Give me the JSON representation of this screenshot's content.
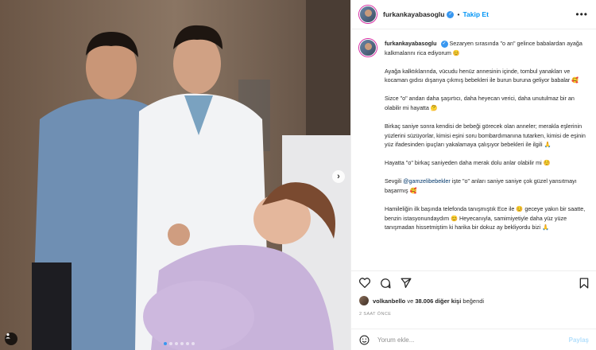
{
  "post": {
    "username": "furkankayabasoglu",
    "verified_glyph": "✓",
    "separator": "•",
    "follow_label": "Takip Et",
    "more_icon": "more-horizontal-icon"
  },
  "caption": {
    "username": "furkankayabasoglu",
    "first_line": "Sezaryen sırasında \"o an\" gelince babalardan ayağa kalkmalarını rica ediyorum 😊",
    "paragraphs": [
      "Ayağa kalktıklarında, vücudu henüz annesinin içinde, tombul yanakları ve kocaman gıdısı dışarıya çıkmış bebekleri ile burun buruna geliyor babalar 🥰",
      "Sizce \"o\" andan daha şaşırtıcı, daha heyecan verici, daha unutulmaz bir an olabilir mi hayatta 🤔",
      "Birkaç saniye sonra kendisi de bebeği görecek olan anneler; merakla eşlerinin yüzlerini süzüyorlar, kimisi eşini soru bombardımanına tutarken, kimisi de eşinin yüz ifadesinden ipuçları yakalamaya çalışıyor bebekleri ile ilgili 🙏",
      "Hayatta \"o\" birkaç saniyeden daha merak dolu anlar olabilir mi ☺️"
    ],
    "mention_prefix": "Sevgili ",
    "mention": "@gamzelibebekler",
    "mention_suffix": " işte \"o\" anları saniye saniye çok güzel yansıtmayı başarmış 🥰",
    "last_paragraph": "Hamileliğin ilk başında telefonda tanışmıştık Ece ile 😊 geceye yakın bir saatte, benzin istasyonundaydım 😊 Heyecanıyla, samimiyetiyle daha yüz yüze tanışmadan hissetmiştim ki harika bir dokuz ay bekliyordu bizi 🙏"
  },
  "actions": {
    "like_icon": "heart-icon",
    "comment_icon": "comment-icon",
    "share_icon": "send-icon",
    "save_icon": "bookmark-icon"
  },
  "likes": {
    "user": "volkanbello",
    "text": " ve ",
    "count": "38.006 diğer kişi",
    "suffix": " beğendi"
  },
  "timestamp": "2 SAAT ÖNCE",
  "comment": {
    "placeholder": "Yorum ekle...",
    "post_label": "Paylaş",
    "emoji_icon": "smile-icon"
  },
  "carousel": {
    "total": 6,
    "active_index": 0
  },
  "colors": {
    "accent": "#0095f6",
    "verified": "#3897f0",
    "mention": "#00376b"
  }
}
